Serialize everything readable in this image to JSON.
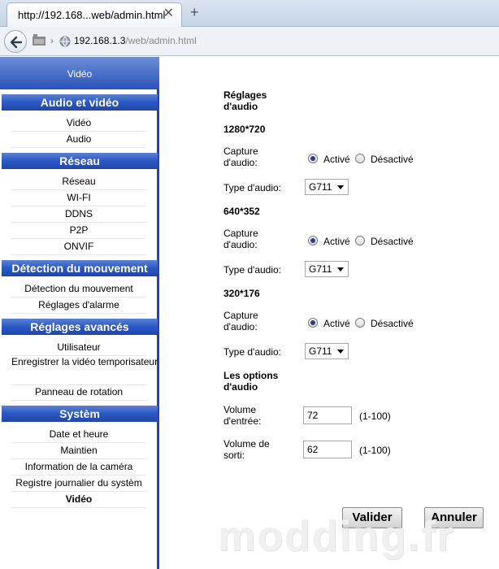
{
  "browser": {
    "tab_title": "http://192.168...web/admin.html",
    "tab_close": "✕",
    "new_tab": "+",
    "url_host": "192.168.1.3",
    "url_path": "/web/admin.html"
  },
  "sidebar": {
    "header": "Vidéo",
    "sections": [
      {
        "title": "Audio et vidéo",
        "items": [
          "Vidéo",
          "Audio"
        ]
      },
      {
        "title": "Réseau",
        "items": [
          "Réseau",
          "WI-FI",
          "DDNS",
          "P2P",
          "ONVIF"
        ]
      },
      {
        "title": "Détection du mouvement",
        "items": [
          "Détection du mouvement",
          "Réglages d'alarme"
        ]
      },
      {
        "title": "Réglages avancés",
        "items": [
          "Utilisateur",
          "Enregistrer la vidéo temporisateur",
          "Panneau de rotation"
        ]
      },
      {
        "title": "Systèm",
        "items": [
          "Date et heure",
          "Maintien",
          "Information de la caméra",
          "Registre journalier du systèm",
          "Vidéo"
        ]
      }
    ],
    "active_item": "Vidéo"
  },
  "content": {
    "title": "Réglages d'audio",
    "profiles": [
      {
        "resolution": "1280*720",
        "capture_label": "Capture d'audio:",
        "enabled_label": "Activé",
        "disabled_label": "Désactivé",
        "selected": "Activé",
        "type_label": "Type d'audio:",
        "type_value": "G711"
      },
      {
        "resolution": "640*352",
        "capture_label": "Capture d'audio:",
        "enabled_label": "Activé",
        "disabled_label": "Désactivé",
        "selected": "Activé",
        "type_label": "Type d'audio:",
        "type_value": "G711"
      },
      {
        "resolution": "320*176",
        "capture_label": "Capture d'audio:",
        "enabled_label": "Activé",
        "disabled_label": "Désactivé",
        "selected": "Activé",
        "type_label": "Type d'audio:",
        "type_value": "G711"
      }
    ],
    "options_title": "Les options d'audio",
    "input_volume_label": "Volume d'entrée:",
    "input_volume_value": "72",
    "input_volume_range": "(1-100)",
    "output_volume_label": "Volume de sorti:",
    "output_volume_value": "62",
    "output_volume_range": "(1-100)",
    "validate_button": "Valider",
    "cancel_button": "Annuler"
  },
  "watermark": "modding.fr",
  "colors": {
    "sidebar_accent": "#1f47a8",
    "radio_dot": "#2b3d7d"
  }
}
